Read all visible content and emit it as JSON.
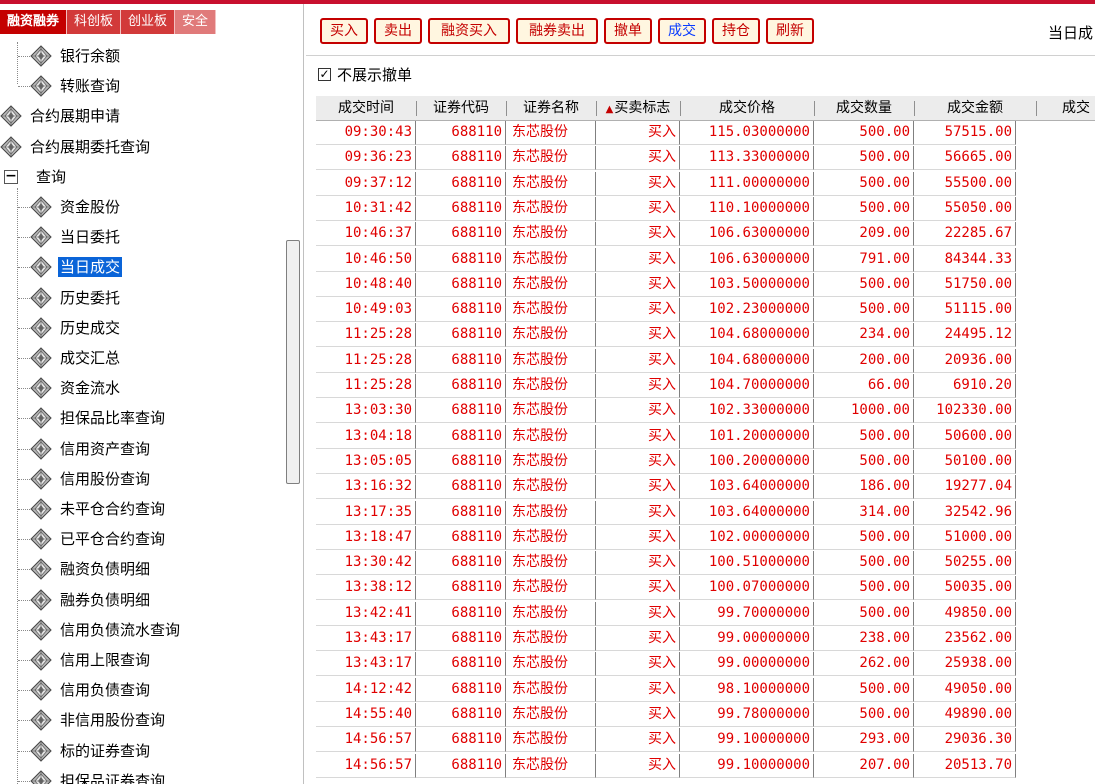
{
  "left_tabs": [
    {
      "label": "融资融券",
      "state": "active"
    },
    {
      "label": "科创板",
      "state": "normal"
    },
    {
      "label": "创业板",
      "state": "normal"
    },
    {
      "label": "安全",
      "state": "dim"
    }
  ],
  "tree_items": [
    {
      "label": "银行余额",
      "level": 1
    },
    {
      "label": "转账查询",
      "level": 1
    },
    {
      "label": "合约展期申请",
      "level": 0
    },
    {
      "label": "合约展期委托查询",
      "level": 0
    },
    {
      "label": "查询",
      "level": 0,
      "expander": "−"
    },
    {
      "label": "资金股份",
      "level": 1
    },
    {
      "label": "当日委托",
      "level": 1
    },
    {
      "label": "当日成交",
      "level": 1,
      "selected": true
    },
    {
      "label": "历史委托",
      "level": 1
    },
    {
      "label": "历史成交",
      "level": 1
    },
    {
      "label": "成交汇总",
      "level": 1
    },
    {
      "label": "资金流水",
      "level": 1
    },
    {
      "label": "担保品比率查询",
      "level": 1
    },
    {
      "label": "信用资产查询",
      "level": 1
    },
    {
      "label": "信用股份查询",
      "level": 1
    },
    {
      "label": "未平仓合约查询",
      "level": 1
    },
    {
      "label": "已平仓合约查询",
      "level": 1
    },
    {
      "label": "融资负债明细",
      "level": 1
    },
    {
      "label": "融券负债明细",
      "level": 1
    },
    {
      "label": "信用负债流水查询",
      "level": 1
    },
    {
      "label": "信用上限查询",
      "level": 1
    },
    {
      "label": "信用负债查询",
      "level": 1
    },
    {
      "label": "非信用股份查询",
      "level": 1
    },
    {
      "label": "标的证券查询",
      "level": 1
    },
    {
      "label": "担保品证券查询",
      "level": 1
    }
  ],
  "toolbar": {
    "buttons": [
      {
        "label": "买入",
        "name": "buy-button"
      },
      {
        "label": "卖出",
        "name": "sell-button"
      },
      {
        "label": "融资买入",
        "name": "margin-buy-button"
      },
      {
        "label": "融券卖出",
        "name": "short-sell-button"
      },
      {
        "label": "撤单",
        "name": "cancel-order-button"
      },
      {
        "label": "成交",
        "name": "trades-button",
        "active": true
      },
      {
        "label": "持仓",
        "name": "positions-button"
      },
      {
        "label": "刷新",
        "name": "refresh-button"
      }
    ],
    "right_label": "当日成"
  },
  "filter": {
    "checked_mark": "✓",
    "label": "不展示撤单"
  },
  "table": {
    "columns": [
      "成交时间",
      "证券代码",
      "证券名称",
      "买卖标志",
      "成交价格",
      "成交数量",
      "成交金额",
      "成交"
    ],
    "sort_marker": "▲",
    "rows": [
      [
        "09:30:43",
        "688110",
        "东芯股份",
        "买入",
        "115.03000000",
        "500.00",
        "57515.00"
      ],
      [
        "09:36:23",
        "688110",
        "东芯股份",
        "买入",
        "113.33000000",
        "500.00",
        "56665.00"
      ],
      [
        "09:37:12",
        "688110",
        "东芯股份",
        "买入",
        "111.00000000",
        "500.00",
        "55500.00"
      ],
      [
        "10:31:42",
        "688110",
        "东芯股份",
        "买入",
        "110.10000000",
        "500.00",
        "55050.00"
      ],
      [
        "10:46:37",
        "688110",
        "东芯股份",
        "买入",
        "106.63000000",
        "209.00",
        "22285.67"
      ],
      [
        "10:46:50",
        "688110",
        "东芯股份",
        "买入",
        "106.63000000",
        "791.00",
        "84344.33"
      ],
      [
        "10:48:40",
        "688110",
        "东芯股份",
        "买入",
        "103.50000000",
        "500.00",
        "51750.00"
      ],
      [
        "10:49:03",
        "688110",
        "东芯股份",
        "买入",
        "102.23000000",
        "500.00",
        "51115.00"
      ],
      [
        "11:25:28",
        "688110",
        "东芯股份",
        "买入",
        "104.68000000",
        "234.00",
        "24495.12"
      ],
      [
        "11:25:28",
        "688110",
        "东芯股份",
        "买入",
        "104.68000000",
        "200.00",
        "20936.00"
      ],
      [
        "11:25:28",
        "688110",
        "东芯股份",
        "买入",
        "104.70000000",
        "66.00",
        "6910.20"
      ],
      [
        "13:03:30",
        "688110",
        "东芯股份",
        "买入",
        "102.33000000",
        "1000.00",
        "102330.00"
      ],
      [
        "13:04:18",
        "688110",
        "东芯股份",
        "买入",
        "101.20000000",
        "500.00",
        "50600.00"
      ],
      [
        "13:05:05",
        "688110",
        "东芯股份",
        "买入",
        "100.20000000",
        "500.00",
        "50100.00"
      ],
      [
        "13:16:32",
        "688110",
        "东芯股份",
        "买入",
        "103.64000000",
        "186.00",
        "19277.04"
      ],
      [
        "13:17:35",
        "688110",
        "东芯股份",
        "买入",
        "103.64000000",
        "314.00",
        "32542.96"
      ],
      [
        "13:18:47",
        "688110",
        "东芯股份",
        "买入",
        "102.00000000",
        "500.00",
        "51000.00"
      ],
      [
        "13:30:42",
        "688110",
        "东芯股份",
        "买入",
        "100.51000000",
        "500.00",
        "50255.00"
      ],
      [
        "13:38:12",
        "688110",
        "东芯股份",
        "买入",
        "100.07000000",
        "500.00",
        "50035.00"
      ],
      [
        "13:42:41",
        "688110",
        "东芯股份",
        "买入",
        "99.70000000",
        "500.00",
        "49850.00"
      ],
      [
        "13:43:17",
        "688110",
        "东芯股份",
        "买入",
        "99.00000000",
        "238.00",
        "23562.00"
      ],
      [
        "13:43:17",
        "688110",
        "东芯股份",
        "买入",
        "99.00000000",
        "262.00",
        "25938.00"
      ],
      [
        "14:12:42",
        "688110",
        "东芯股份",
        "买入",
        "98.10000000",
        "500.00",
        "49050.00"
      ],
      [
        "14:55:40",
        "688110",
        "东芯股份",
        "买入",
        "99.78000000",
        "500.00",
        "49890.00"
      ],
      [
        "14:56:57",
        "688110",
        "东芯股份",
        "买入",
        "99.10000000",
        "293.00",
        "29036.30"
      ],
      [
        "14:56:57",
        "688110",
        "东芯股份",
        "买入",
        "99.10000000",
        "207.00",
        "20513.70"
      ]
    ]
  },
  "colors": {
    "brand_red": "#c40000",
    "trade_text": "#e00000",
    "selection": "#0a64d8"
  },
  "icons": {
    "tree_node": "diamond-gem-icon",
    "expander": "collapse-minus-icon",
    "checkbox": "check-icon"
  }
}
